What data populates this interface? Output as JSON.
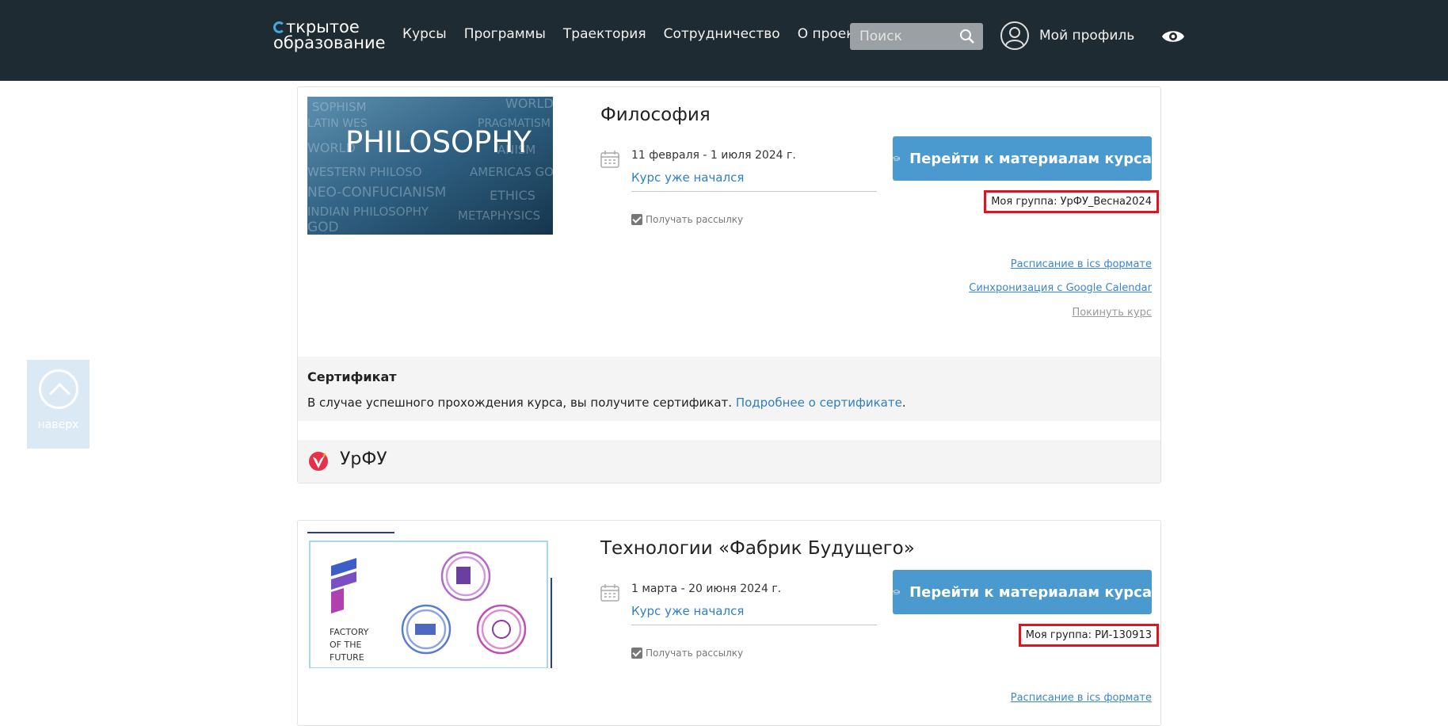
{
  "header": {
    "logo_line1": "ткрытое",
    "logo_line2": "образование",
    "nav": [
      "Курсы",
      "Программы",
      "Траектория",
      "Сотрудничество",
      "О проекте"
    ],
    "search_placeholder": "Поиск",
    "profile_label": "Мой профиль"
  },
  "back_to_top": {
    "label": "наверх"
  },
  "courses": [
    {
      "title": "Философия",
      "dates": "11 февраля - 1 июля 2024 г.",
      "status": "Курс уже начался",
      "mailing_label": "Получать рассылку",
      "go_button": "Перейти к материалам курса",
      "group": "Моя группа: УрФУ_Весна2024",
      "link_ics": "Расписание в ics формате",
      "link_gcal": "Синхронизация с Google Calendar",
      "link_leave": "Покинуть курс",
      "thumb_text": "PHILOSOPHY",
      "cert_title": "Сертификат",
      "cert_text": "В случае успешного прохождения курса, вы получите сертификат.",
      "cert_link": "Подробнее о сертификате",
      "cert_end": ".",
      "university": "УрФУ"
    },
    {
      "title": "Технологии «Фабрик Будущего»",
      "dates": "1 марта - 20 июня 2024 г.",
      "status": "Курс уже начался",
      "mailing_label": "Получать рассылку",
      "go_button": "Перейти к материалам курса",
      "group": "Моя группа: РИ-130913",
      "link_ics": "Расписание в ics формате",
      "thumb_text_1": "FACTORY",
      "thumb_text_2": "OF THE",
      "thumb_text_3": "FUTURE"
    }
  ]
}
